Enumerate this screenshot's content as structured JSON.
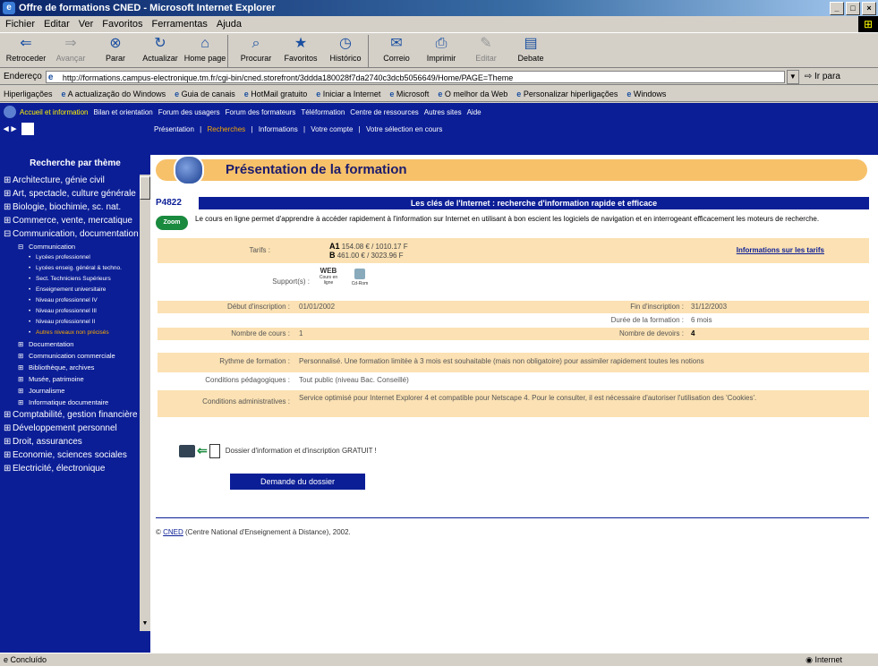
{
  "window": {
    "title": "Offre de formations CNED - Microsoft Internet Explorer",
    "controls": [
      "_",
      "□",
      "×"
    ]
  },
  "menu": [
    "Fichier",
    "Editar",
    "Ver",
    "Favoritos",
    "Ferramentas",
    "Ajuda"
  ],
  "toolbar": [
    {
      "label": "Retroceder",
      "icon": "back-icon",
      "disabled": false
    },
    {
      "label": "Avançar",
      "icon": "forward-icon",
      "disabled": true
    },
    {
      "label": "Parar",
      "icon": "stop-icon",
      "disabled": false
    },
    {
      "label": "Actualizar",
      "icon": "refresh-icon",
      "disabled": false
    },
    {
      "label": "Home page",
      "icon": "home-icon",
      "disabled": false
    },
    {
      "label": "Procurar",
      "icon": "search-icon",
      "disabled": false
    },
    {
      "label": "Favoritos",
      "icon": "favorites-icon",
      "disabled": false
    },
    {
      "label": "Histórico",
      "icon": "history-icon",
      "disabled": false
    },
    {
      "label": "Correio",
      "icon": "mail-icon",
      "disabled": false
    },
    {
      "label": "Imprimir",
      "icon": "print-icon",
      "disabled": false
    },
    {
      "label": "Editar",
      "icon": "edit-icon",
      "disabled": true
    },
    {
      "label": "Debate",
      "icon": "discuss-icon",
      "disabled": false
    }
  ],
  "address": {
    "label": "Endereço",
    "url": "http://formations.campus-electronique.tm.fr/cgi-bin/cned.storefront/3ddda180028f7da2740c3dcb5056649/Home/PAGE=Theme",
    "go": "Ir para"
  },
  "links": {
    "label": "Hiperligações",
    "items": [
      "A actualização do Windows",
      "Guia de canais",
      "HotMail gratuito",
      "Iniciar a Internet",
      "Microsoft",
      "O melhor da Web",
      "Personalizar hiperligações",
      "Windows"
    ]
  },
  "site_nav": {
    "top": [
      "Accueil et information",
      "Bilan et orientation",
      "Forum des usagers",
      "Forum des formateurs",
      "Téléformation",
      "Centre de ressources",
      "Autres sites",
      "Aide"
    ],
    "sub": [
      "Présentation",
      "Recherches",
      "Informations",
      "Votre compte",
      "Votre sélection en cours"
    ],
    "sub_active": "Recherches",
    "sub_separators": [
      "|",
      "|",
      "|",
      "|"
    ]
  },
  "sidebar": {
    "header": "Recherche par thème",
    "items": [
      {
        "level": 1,
        "sign": "⊞",
        "label": "Architecture, génie civil"
      },
      {
        "level": 1,
        "sign": "⊞",
        "label": "Art, spectacle, culture générale"
      },
      {
        "level": 1,
        "sign": "⊞",
        "label": "Biologie, biochimie, sc. nat."
      },
      {
        "level": 1,
        "sign": "⊞",
        "label": "Commerce, vente, mercatique"
      },
      {
        "level": 1,
        "sign": "⊟",
        "label": "Communication, documentation"
      },
      {
        "level": 2,
        "sign": "⊟",
        "label": "Communication"
      },
      {
        "level": 3,
        "sign": "•",
        "label": "Lycées professionnel",
        "active": false
      },
      {
        "level": 3,
        "sign": "•",
        "label": "Lycées enseig. général & techno.",
        "active": false
      },
      {
        "level": 3,
        "sign": "•",
        "label": "Sect. Techniciens Supérieurs",
        "active": false
      },
      {
        "level": 3,
        "sign": "•",
        "label": "Enseignement universitaire",
        "active": false
      },
      {
        "level": 3,
        "sign": "•",
        "label": "Niveau professionnel IV",
        "active": false
      },
      {
        "level": 3,
        "sign": "•",
        "label": "Niveau professionnel III",
        "active": false
      },
      {
        "level": 3,
        "sign": "•",
        "label": "Niveau professionnel II",
        "active": false
      },
      {
        "level": 3,
        "sign": "•",
        "label": "Autres niveaux non précisés",
        "active": true
      },
      {
        "level": 2,
        "sign": "⊞",
        "label": "Documentation"
      },
      {
        "level": 2,
        "sign": "⊞",
        "label": "Communication commerciale"
      },
      {
        "level": 2,
        "sign": "⊞",
        "label": "Bibliothèque, archives"
      },
      {
        "level": 2,
        "sign": "⊞",
        "label": "Musée, patrimoine"
      },
      {
        "level": 2,
        "sign": "⊞",
        "label": "Journalisme"
      },
      {
        "level": 2,
        "sign": "⊞",
        "label": "Informatique documentaire"
      },
      {
        "level": 1,
        "sign": "⊞",
        "label": "Comptabilité, gestion financière"
      },
      {
        "level": 1,
        "sign": "⊞",
        "label": "Développement personnel"
      },
      {
        "level": 1,
        "sign": "⊞",
        "label": "Droit, assurances"
      },
      {
        "level": 1,
        "sign": "⊞",
        "label": "Economie, sciences sociales"
      },
      {
        "level": 1,
        "sign": "⊞",
        "label": "Electricité, électronique"
      }
    ]
  },
  "main": {
    "header": "Présentation de la formation",
    "code": "P4822",
    "course_title": "Les clés de l'Internet : recherche d'information rapide et efficace",
    "zoom": "Zoom",
    "description": "Le cours en ligne permet d'apprendre à accéder rapidement à l'information sur Internet en utilisant à bon escient les logiciels de navigation et en interrogeant efficacement les moteurs de recherche.",
    "tarifs_label": "Tarifs :",
    "tarif_a_code": "A1",
    "tarif_a": "154.08 € / 1010.17 F",
    "tarif_b_code": "B",
    "tarif_b": "461.00 € / 3023.96 F",
    "tarif_link": "Informations sur les tarifs",
    "supports_label": "Support(s) :",
    "support_web": "WEB",
    "support_web_caption": "Cours en ligne",
    "support_cd": "Cd-Rom",
    "debut_label": "Début d'inscription :",
    "debut": "01/01/2002",
    "fin_label": "Fin d'inscription :",
    "fin": "31/12/2003",
    "duree_label": "Durée de la formation :",
    "duree": "6 mois",
    "cours_label": "Nombre de cours :",
    "cours": "1",
    "devoirs_label": "Nombre de devoirs :",
    "devoirs": "4",
    "rythme_label": "Rythme de formation :",
    "rythme": "Personnalisé. Une formation limitée à 3 mois est souhaitable (mais non obligatoire) pour assimiler rapidement toutes les notions",
    "peda_label": "Conditions pédagogiques :",
    "peda": "Tout public (niveau Bac. Conseillé)",
    "admin_label": "Conditions administratives :",
    "admin": "Service optimisé pour Internet Explorer 4 et compatible pour Netscape 4. Pour le consulter, il est nécessaire d'autoriser l'utilisation des 'Cookies'.",
    "dossier": "Dossier d'information et d'inscription GRATUIT !",
    "button": "Demande du dossier",
    "copyright_prefix": "© ",
    "copyright_link": "CNED",
    "copyright_text": " (Centre National d'Enseignement à Distance), 2002."
  },
  "status": {
    "left": "Concluído",
    "zone": "Internet"
  }
}
